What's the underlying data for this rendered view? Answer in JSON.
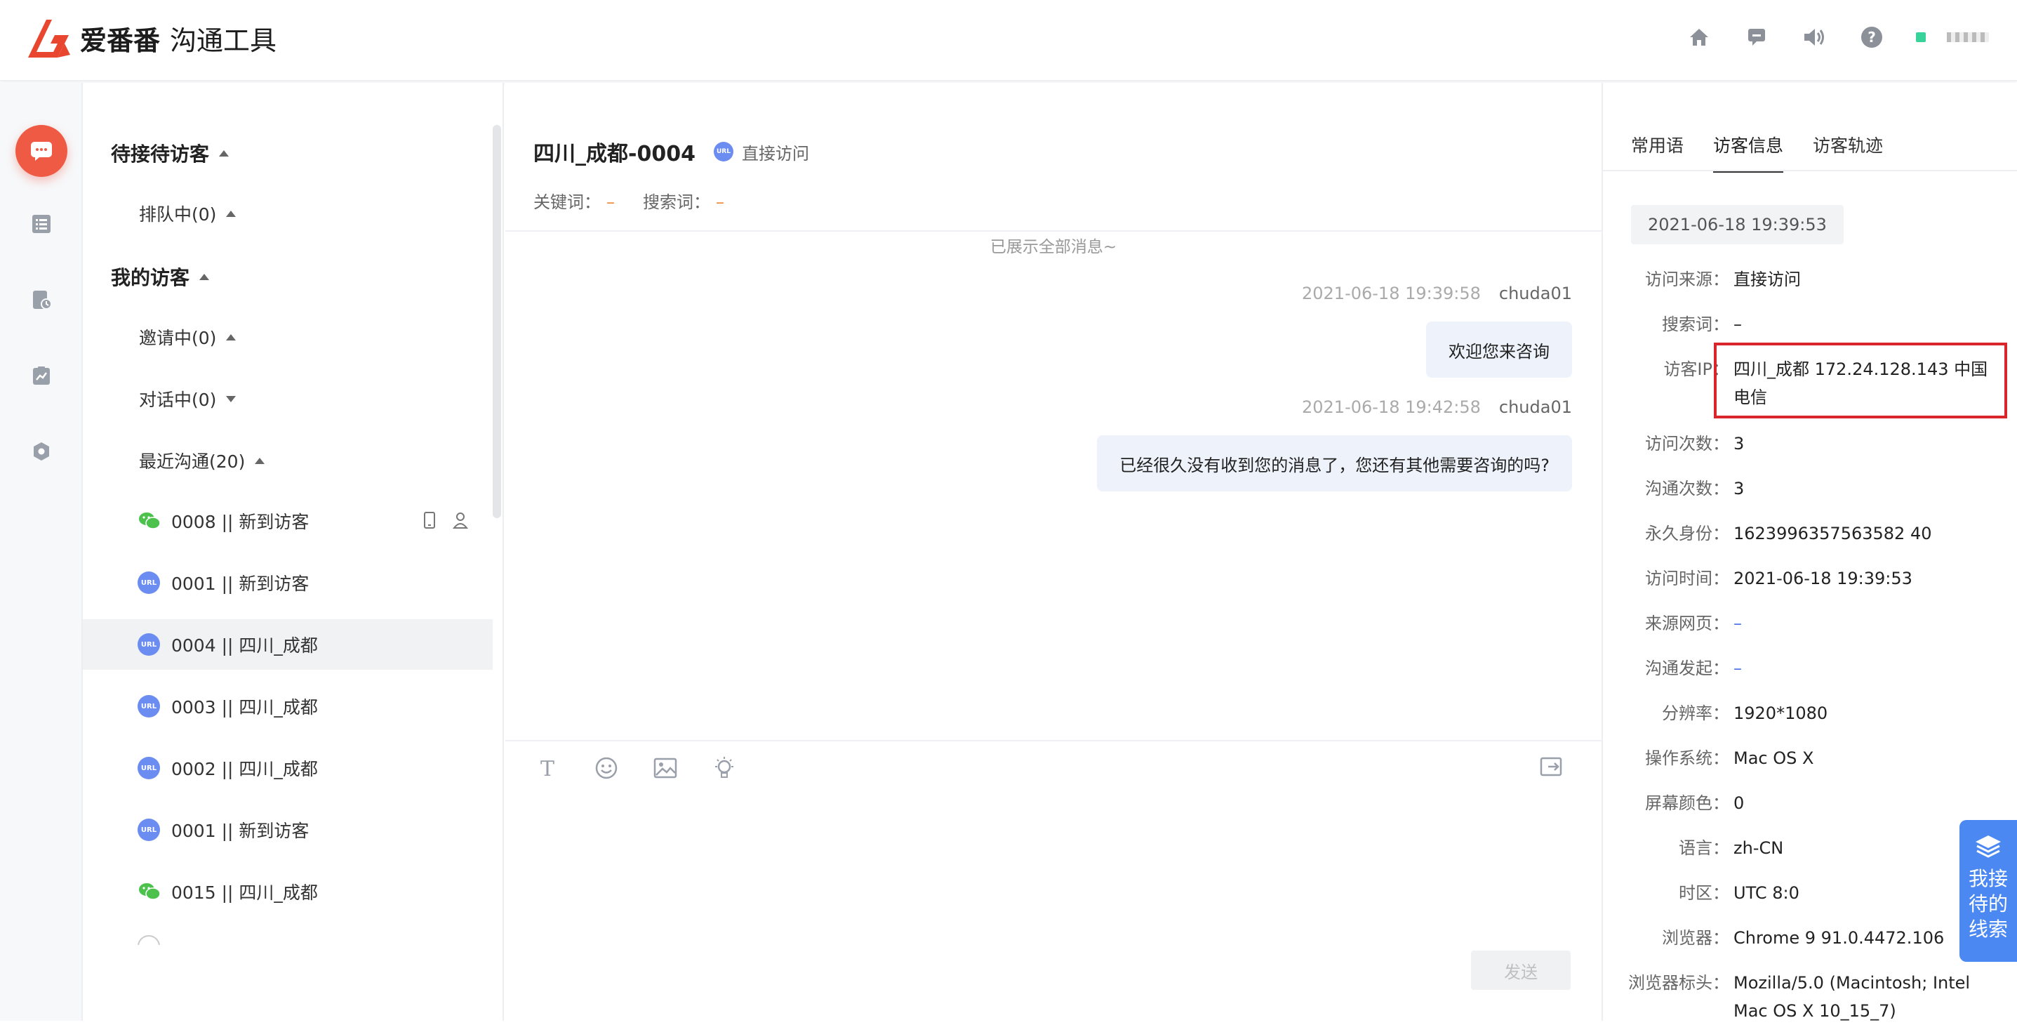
{
  "app": {
    "brand": "爱番番",
    "product": "沟通工具"
  },
  "topbar": {
    "icons": [
      "home-icon",
      "message-icon",
      "speaker-icon",
      "help-icon"
    ],
    "status_color": "#37d39a"
  },
  "visitors": {
    "waiting": "待接待访客",
    "queue": "排队中(0)",
    "mine": "我的访客",
    "inviting": "邀请中(0)",
    "talking": "对话中(0)",
    "recent": "最近沟通(20)",
    "rows": [
      {
        "icon": "wechat",
        "label": "0008 || 新到访客"
      },
      {
        "icon": "url",
        "label": "0001 || 新到访客"
      },
      {
        "icon": "url",
        "label": "0004 || 四川_成都"
      },
      {
        "icon": "url",
        "label": "0003 || 四川_成都"
      },
      {
        "icon": "url",
        "label": "0002 || 四川_成都"
      },
      {
        "icon": "url",
        "label": "0001 || 新到访客"
      },
      {
        "icon": "wechat",
        "label": "0015 || 四川_成都"
      }
    ],
    "url_badge": "URL"
  },
  "chat": {
    "title": "四川_成都-0004",
    "source_badge": "URL",
    "source": "直接访问",
    "keyword_label": "关键词：",
    "keyword": "–",
    "search_label": "搜索词：",
    "search": "–",
    "all_shown": "已展示全部消息~",
    "messages": [
      {
        "time": "2021-06-18 19:39:58",
        "agent": "chuda01",
        "text": "欢迎您来咨询"
      },
      {
        "time": "2021-06-18 19:42:58",
        "agent": "chuda01",
        "text": "已经很久没有收到您的消息了，您还有其他需要咨询的吗?"
      }
    ],
    "send_label": "发送"
  },
  "panel": {
    "tabs": [
      "常用语",
      "访客信息",
      "访客轨迹"
    ],
    "timestamp": "2021-06-18 19:39:53",
    "fields": [
      {
        "k": "访问来源：",
        "v": "直接访问"
      },
      {
        "k": "搜索词：",
        "v": "–"
      },
      {
        "k": "访客IP：",
        "v": "四川_成都 172.24.128.143 中国电信"
      },
      {
        "k": "访问次数：",
        "v": "3"
      },
      {
        "k": "沟通次数：",
        "v": "3"
      },
      {
        "k": "永久身份：",
        "v": "1623996357563582 40"
      },
      {
        "k": "访问时间：",
        "v": "2021-06-18 19:39:53"
      },
      {
        "k": "来源网页：",
        "v": "–"
      },
      {
        "k": "沟通发起：",
        "v": "–"
      },
      {
        "k": "分辨率：",
        "v": "1920*1080"
      },
      {
        "k": "操作系统：",
        "v": "Mac OS X"
      },
      {
        "k": "屏幕颜色：",
        "v": "0"
      },
      {
        "k": "语言：",
        "v": "zh-CN"
      },
      {
        "k": "时区：",
        "v": "UTC 8:0"
      },
      {
        "k": "浏览器：",
        "v": "Chrome 9 91.0.4472.106"
      },
      {
        "k": "浏览器标头：",
        "v": "Mozilla/5.0 (Macintosh; Intel Mac OS X 10_15_7)"
      }
    ]
  },
  "float": {
    "label": "我接待的线索"
  }
}
